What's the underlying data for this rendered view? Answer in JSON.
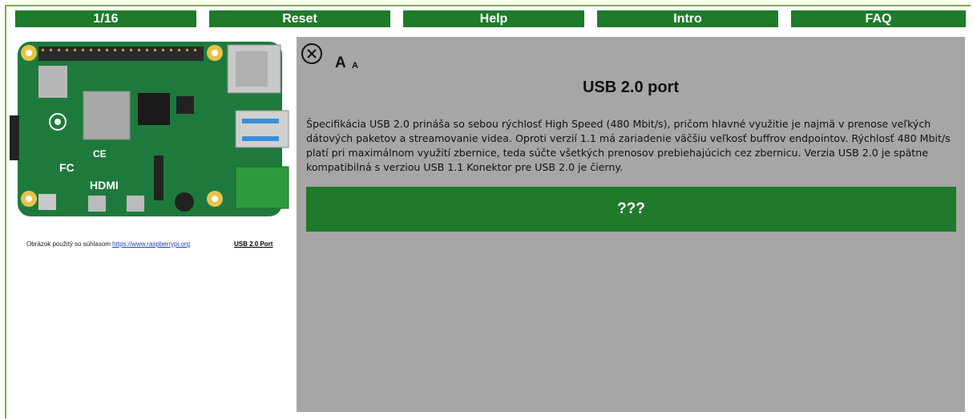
{
  "nav": {
    "counter": "1/16",
    "reset": "Reset",
    "help": "Help",
    "intro": "Intro",
    "faq": "FAQ"
  },
  "image_credit": {
    "text": "Obrázok použitý so súhlasom ",
    "link": "https://www.raspberrypi.org",
    "port_label": "USB 2.0 Port"
  },
  "panel": {
    "font_large": "A",
    "font_small": "A",
    "title": "USB 2.0 port",
    "description": "Špecifikácia USB 2.0 prináša so sebou rýchlosť High Speed (480 Mbit/s), pričom hlavné využitie je najmä v prenose veľkých dátových paketov a streamovanie videa. Oproti verzií 1.1 má zariadenie väčšiu veľkosť buffrov endpointov. Rýchlosť 480 Mbit/s platí pri maximálnom využití zbernice, teda súčte všetkých prenosov prebiehajúcich cez zbernicu. Verzia USB 2.0 je spätne kompatibilná s verziou USB 1.1 Konektor pre USB 2.0 je čierny.",
    "answer_button": "???"
  },
  "colors": {
    "accent_green": "#1f7a2b",
    "panel_gray": "#a6a6a6",
    "frame_green": "#7fae3a"
  },
  "icons": {
    "close": "close-circle-icon"
  }
}
